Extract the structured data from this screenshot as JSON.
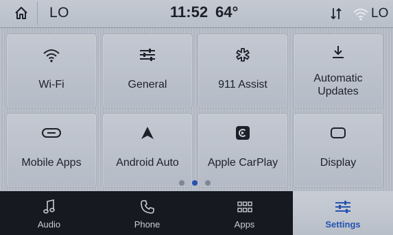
{
  "status_bar": {
    "left_label": "LO",
    "time": "11:52",
    "temperature": "64°",
    "right_label": "LO"
  },
  "tiles": [
    {
      "label": "Wi-Fi",
      "icon": "wifi-icon"
    },
    {
      "label": "General",
      "icon": "sliders-icon"
    },
    {
      "label": "911 Assist",
      "icon": "asterisk-icon"
    },
    {
      "label": "Automatic Updates",
      "icon": "download-icon"
    },
    {
      "label": "Mobile Apps",
      "icon": "link-icon"
    },
    {
      "label": "Android Auto",
      "icon": "android-auto-icon"
    },
    {
      "label": "Apple CarPlay",
      "icon": "carplay-icon"
    },
    {
      "label": "Display",
      "icon": "display-icon"
    }
  ],
  "pagination": {
    "pages": 3,
    "current": 2
  },
  "nav": {
    "items": [
      {
        "label": "Audio",
        "icon": "music-note-icon"
      },
      {
        "label": "Phone",
        "icon": "phone-icon"
      },
      {
        "label": "Apps",
        "icon": "apps-grid-icon"
      },
      {
        "label": "Settings",
        "icon": "sliders-icon"
      }
    ],
    "active": "Settings"
  },
  "colors": {
    "accent": "#2553b0",
    "nav_bg": "#16191f",
    "tile_bg": "#bcc2cc"
  }
}
